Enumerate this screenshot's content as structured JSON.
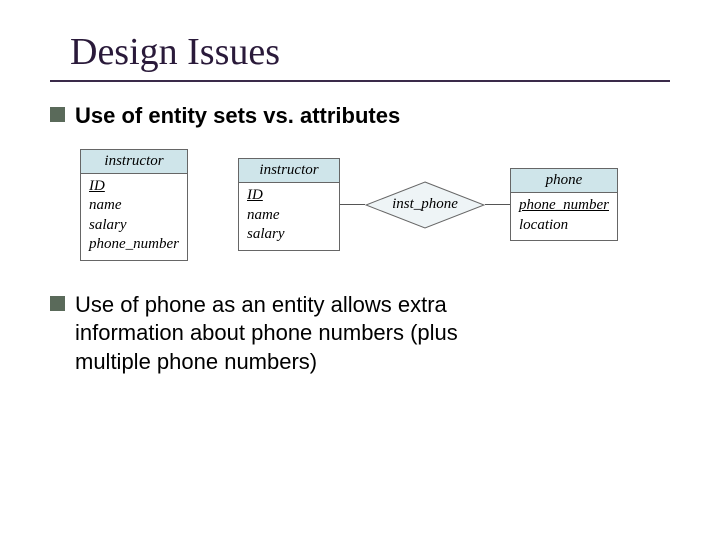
{
  "title": "Design Issues",
  "bullets": {
    "b1": "Use of entity sets vs. attributes",
    "b2_line1": "Use of phone as an entity allows extra",
    "b2_line2": "information about phone numbers (plus",
    "b2_line3": "multiple phone numbers)"
  },
  "diagram": {
    "left": {
      "name": "instructor",
      "attrs": {
        "key": "ID",
        "a1": "name",
        "a2": "salary",
        "a3": "phone_number"
      }
    },
    "mid_entity": {
      "name": "instructor",
      "attrs": {
        "key": "ID",
        "a1": "name",
        "a2": "salary"
      }
    },
    "relationship": "inst_phone",
    "right_entity": {
      "name": "phone",
      "attrs": {
        "key": "phone_number",
        "a1": "location"
      }
    }
  }
}
